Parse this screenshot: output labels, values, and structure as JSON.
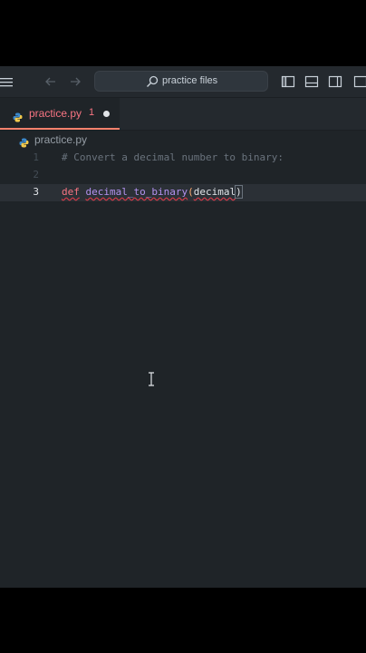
{
  "titlebar": {
    "search_text": "practice files",
    "icons": [
      "menu-icon",
      "arrow-left-icon",
      "arrow-right-icon",
      "search-icon",
      "toggle-primary-sidebar-icon",
      "toggle-panel-icon",
      "toggle-secondary-sidebar-icon"
    ]
  },
  "tab": {
    "label": "practice.py",
    "problems_count": "1",
    "dirty": true
  },
  "breadcrumb": {
    "file": "practice.py"
  },
  "editor": {
    "lines": [
      {
        "number": "1",
        "comment": "# Convert a decimal number to binary:"
      },
      {
        "number": "2"
      },
      {
        "number": "3",
        "keyword": "def",
        "function": "decimal_to_binary",
        "open_paren": "(",
        "param": "decimal",
        "close_paren": ")"
      }
    ],
    "current_line": "3"
  },
  "colors": {
    "editor_bg": "#1f2428",
    "chrome_bg": "#24292e",
    "keyword": "#f97583",
    "function": "#b392f0",
    "comment": "#6a737d",
    "accent": "#f9826c"
  }
}
